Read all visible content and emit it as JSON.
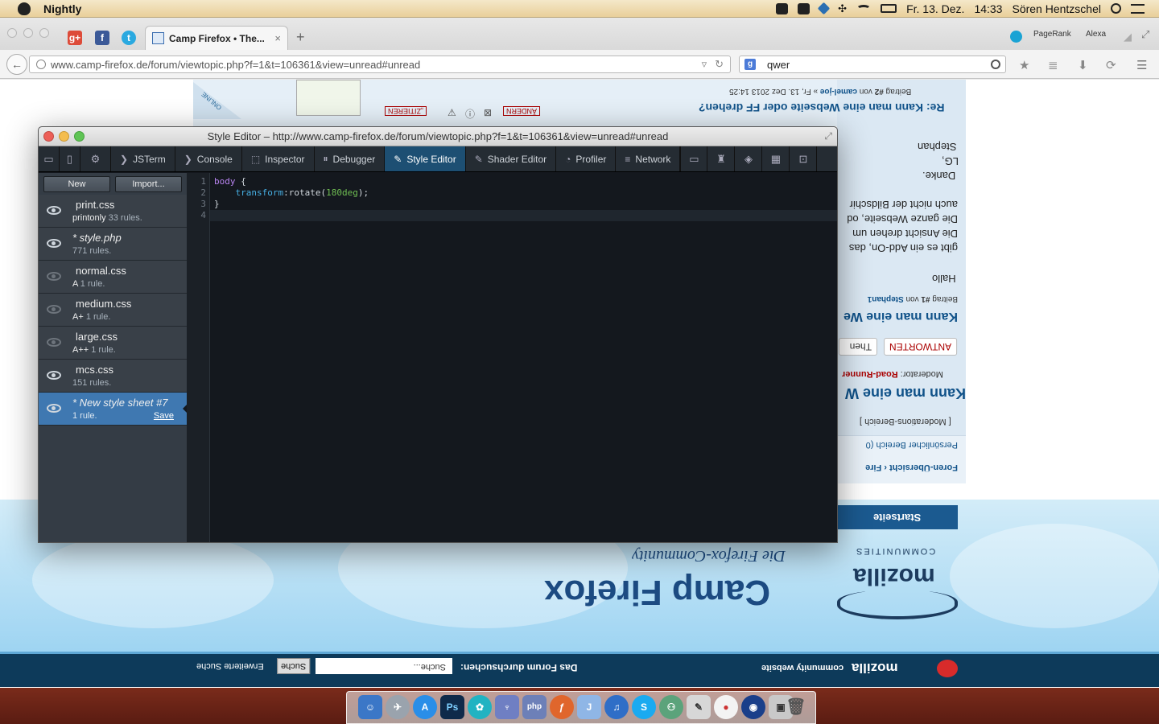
{
  "menubar": {
    "app_name": "Nightly",
    "date": "Fr. 13. Dez.",
    "time": "14:33",
    "user": "Sören Hentzschel"
  },
  "browser": {
    "tab_title": "Camp Firefox • The...",
    "tab_close": "×",
    "new_tab": "+",
    "pagerank_label": "PageRank",
    "alexa_label": "Alexa",
    "url": "www.camp-firefox.de/forum/viewtopic.php?f=1&t=106361&view=unread#unread",
    "search_value": "qwer"
  },
  "page": {
    "post_title": "Re: Kann man eine Webseite oder FF drehen?",
    "post_meta_prefix": "Beitrag ",
    "post_number": "#2",
    "post_meta_von": " von ",
    "post_author": "camel-joe",
    "post_meta_date": " » Fr, 13. Dez 2013 14:25",
    "online_badge": "ONLINE",
    "btn_zitieren": "„ZITIEREN",
    "btn_aendern": "ÄNDERN",
    "body_lines": [
      "Stephan",
      "LG,",
      "Danke.",
      "auch nicht der Bildschir",
      "Die ganze Webseite, od",
      "Die Ansicht drehen um",
      "gibt es ein Add-On, das",
      "Hallo"
    ],
    "first_post_meta_prefix": "Beitrag ",
    "first_post_number": "#1",
    "first_post_von": " von ",
    "first_post_author": "Stephan1",
    "first_post_title": "Kann man eine We",
    "btn_antworten": "ANTWORTEN",
    "btn_thema": "Then",
    "moderator_label": "Moderator: ",
    "moderator_name": "Road-Runner",
    "topic_title": "Kann man eine W",
    "mod_area": "[ Moderations-Bereich ]",
    "personal_area": "Persönlicher Bereich (0",
    "breadcrumb": "Foren-Übersicht ‹ Fire",
    "startseite": "Startseite",
    "mozilla": "mozilla",
    "communities": "COMMUNITIES",
    "site_title": "Camp Firefox",
    "tagline": "Die Firefox-Community",
    "footer_brand": "mozilla",
    "footer_brand_sub": "community website",
    "footer_search_label": "Das Forum durchsuchen:",
    "footer_search_placeholder": "Suche...",
    "footer_search_button": "Suche",
    "footer_adv_search": "Erweiterte Suche"
  },
  "devtools": {
    "window_title": "Style Editor – http://www.camp-firefox.de/forum/viewtopic.php?f=1&t=106361&view=unread#unread",
    "tabs": [
      {
        "label": "JSTerm"
      },
      {
        "label": "Console"
      },
      {
        "label": "Inspector"
      },
      {
        "label": "Debugger"
      },
      {
        "label": "Style Editor"
      },
      {
        "label": "Shader Editor"
      },
      {
        "label": "Profiler"
      },
      {
        "label": "Network"
      }
    ],
    "new_button": "New",
    "import_button": "Import...",
    "sheets": [
      {
        "name": "print.css",
        "media": "printonly",
        "rules": "33 rules."
      },
      {
        "name": "* style.php",
        "media": "",
        "rules": "771 rules."
      },
      {
        "name": "normal.css",
        "media": "A",
        "rules": "1 rule."
      },
      {
        "name": "medium.css",
        "media": "A+",
        "rules": "1 rule."
      },
      {
        "name": "large.css",
        "media": "A++",
        "rules": "1 rule."
      },
      {
        "name": "mcs.css",
        "media": "",
        "rules": "151 rules."
      },
      {
        "name": "* New style sheet #7",
        "media": "",
        "rules": "1 rule.",
        "save": "Save"
      }
    ],
    "line_numbers": [
      "1",
      "2",
      "3",
      "4"
    ],
    "code": {
      "selector": "body",
      "open_brace": " {",
      "property": "transform",
      "colon": ":",
      "value_func": "rotate(",
      "value_num": "180deg",
      "value_close": ");",
      "close_brace": "}"
    }
  },
  "colors": {
    "active_tab": "#1d4f73",
    "active_sheet": "#3f78b1",
    "editor_bg": "#14181e"
  }
}
